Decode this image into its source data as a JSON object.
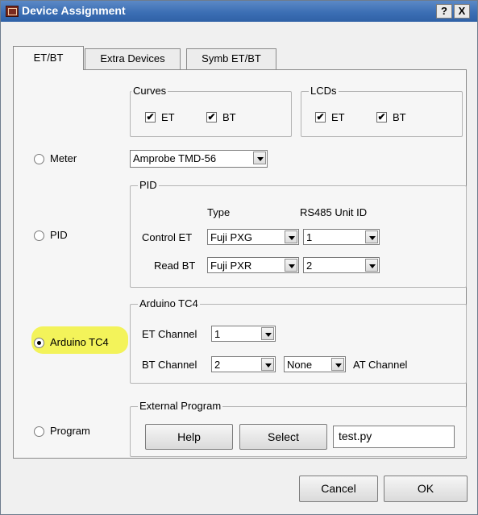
{
  "window": {
    "title": "Device Assignment",
    "help_label": "?",
    "close_label": "X"
  },
  "tabs": [
    {
      "label": "ET/BT",
      "active": true
    },
    {
      "label": "Extra Devices",
      "active": false
    },
    {
      "label": "Symb ET/BT",
      "active": false
    }
  ],
  "curves": {
    "title": "Curves",
    "et_label": "ET",
    "et_checked": true,
    "bt_label": "BT",
    "bt_checked": true
  },
  "lcds": {
    "title": "LCDs",
    "et_label": "ET",
    "et_checked": true,
    "bt_label": "BT",
    "bt_checked": true
  },
  "check_glyph": "✔",
  "devices": {
    "meter": {
      "label": "Meter",
      "selected": false
    },
    "pid": {
      "label": "PID",
      "selected": false
    },
    "arduino": {
      "label": "Arduino TC4",
      "selected": true,
      "highlighted": true
    },
    "program": {
      "label": "Program",
      "selected": false
    }
  },
  "meter_select": "Amprobe TMD-56",
  "pid": {
    "title": "PID",
    "type_header": "Type",
    "unit_header": "RS485 Unit ID",
    "control_label": "Control ET",
    "control_type": "Fuji PXG",
    "control_unit": "1",
    "read_label": "Read BT",
    "read_type": "Fuji PXR",
    "read_unit": "2"
  },
  "arduino": {
    "title": "Arduino TC4",
    "et_label": "ET Channel",
    "et_value": "1",
    "bt_label": "BT Channel",
    "bt_value": "2",
    "at_value": "None",
    "at_label": "AT Channel"
  },
  "external": {
    "title": "External Program",
    "help_label": "Help",
    "select_label": "Select",
    "file_value": "test.py"
  },
  "footer": {
    "cancel_label": "Cancel",
    "ok_label": "OK"
  },
  "colors": {
    "titlebar": "#3a6db3",
    "highlight": "#f3f35a",
    "dialog_bg": "#f0f0f0"
  }
}
